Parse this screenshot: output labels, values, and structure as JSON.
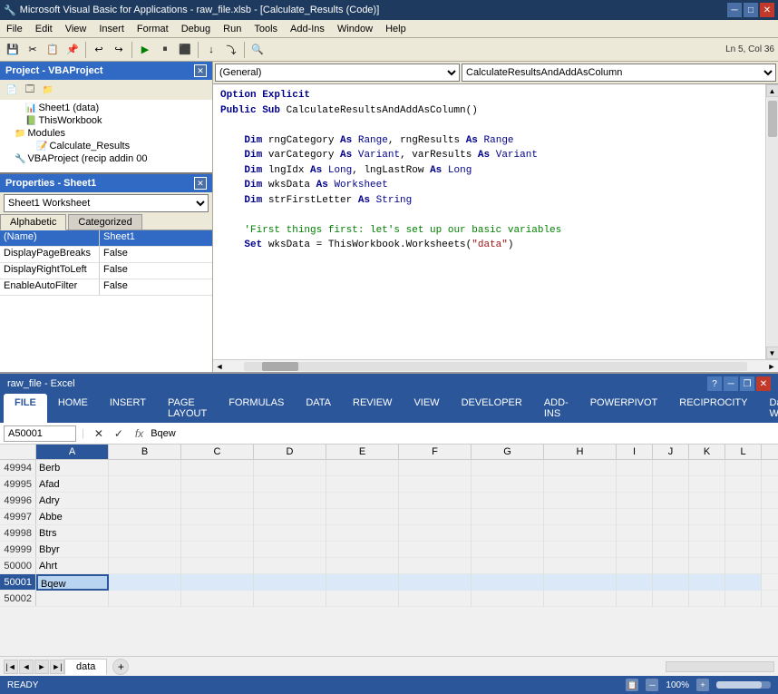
{
  "titleBar": {
    "title": "Microsoft Visual Basic for Applications - raw_file.xlsb - [Calculate_Results (Code)]",
    "minLabel": "─",
    "maxLabel": "□",
    "closeLabel": "✕"
  },
  "vbeMenubar": {
    "items": [
      "File",
      "Edit",
      "View",
      "Insert",
      "Format",
      "Debug",
      "Run",
      "Tools",
      "Add-Ins",
      "Window",
      "Help"
    ]
  },
  "vbeToolbar": {
    "statusText": "Ln 5, Col 36"
  },
  "projectPanel": {
    "title": "Project - VBAProject",
    "tree": [
      {
        "label": "Sheet1 (data)",
        "indent": 2
      },
      {
        "label": "ThisWorkbook",
        "indent": 2
      },
      {
        "label": "Modules",
        "indent": 1
      },
      {
        "label": "Calculate_Results",
        "indent": 3
      },
      {
        "label": "VBAProject (recip addin 00",
        "indent": 1
      }
    ]
  },
  "propertiesPanel": {
    "title": "Properties - Sheet1",
    "selectValue": "Sheet1  Worksheet",
    "tabs": [
      "Alphabetic",
      "Categorized"
    ],
    "activeTab": "Alphabetic",
    "rows": [
      {
        "name": "(Name)",
        "value": "Sheet1",
        "selected": true
      },
      {
        "name": "DisplayPageBreaks",
        "value": "False",
        "selected": false
      },
      {
        "name": "DisplayRightToLeft",
        "value": "False",
        "selected": false
      },
      {
        "name": "EnableAutoFilter",
        "value": "False",
        "selected": false
      }
    ]
  },
  "codeEditor": {
    "dropdownLeft": "(General)",
    "dropdownRight": "CalculateResultsAndAddAsColumn",
    "lines": [
      {
        "text": "Option Explicit",
        "type": "keyword"
      },
      {
        "text": "Public Sub CalculateResultsAndAddAsColumn()",
        "type": "mixed"
      },
      {
        "text": "",
        "type": "plain"
      },
      {
        "text": "    Dim rngCategory As Range, rngResults As Range",
        "type": "mixed"
      },
      {
        "text": "    Dim varCategory As Variant, varResults As Variant",
        "type": "mixed"
      },
      {
        "text": "    Dim lngIdx As Long, lngLastRow As Long",
        "type": "mixed"
      },
      {
        "text": "    Dim wksData As Worksheet",
        "type": "mixed"
      },
      {
        "text": "    Dim strFirstLetter As String",
        "type": "mixed"
      },
      {
        "text": "",
        "type": "plain"
      },
      {
        "text": "    'First things first: let's set up our basic variables",
        "type": "comment"
      },
      {
        "text": "    Set wksData = ThisWorkbook.Worksheets(\"data\")",
        "type": "mixed"
      }
    ]
  },
  "excelTitle": {
    "title": "raw_file - Excel",
    "helpBtn": "?",
    "minLabel": "─",
    "maxLabel": "□",
    "restoreLabel": "❐",
    "closeLabel": "✕"
  },
  "excelRibbon": {
    "tabs": [
      "FILE",
      "HOME",
      "INSERT",
      "PAGE LAYOUT",
      "FORMULAS",
      "DATA",
      "REVIEW",
      "VIEW",
      "DEVELOPER",
      "ADD-INS",
      "POWERPIVOT",
      "RECIPROCITY",
      "Dan Wag..."
    ],
    "activeTab": "FILE"
  },
  "formulaBar": {
    "nameBox": "A50001",
    "fxLabel": "fx",
    "value": "Bqew",
    "cancelBtn": "✕",
    "confirmBtn": "✓"
  },
  "columnHeaders": [
    "A",
    "B",
    "C",
    "D",
    "E",
    "F",
    "G",
    "H",
    "I",
    "J",
    "K",
    "L"
  ],
  "gridRows": [
    {
      "rowNum": "49994",
      "a": "Berb",
      "b": "",
      "c": "",
      "d": "",
      "e": "",
      "f": "",
      "g": "",
      "h": ""
    },
    {
      "rowNum": "49995",
      "a": "Afad",
      "b": "",
      "c": "",
      "d": "",
      "e": "",
      "f": "",
      "g": "",
      "h": ""
    },
    {
      "rowNum": "49996",
      "a": "Adry",
      "b": "",
      "c": "",
      "d": "",
      "e": "",
      "f": "",
      "g": "",
      "h": ""
    },
    {
      "rowNum": "49997",
      "a": "Abbe",
      "b": "",
      "c": "",
      "d": "",
      "e": "",
      "f": "",
      "g": "",
      "h": ""
    },
    {
      "rowNum": "49998",
      "a": "Btrs",
      "b": "",
      "c": "",
      "d": "",
      "e": "",
      "f": "",
      "g": "",
      "h": ""
    },
    {
      "rowNum": "49999",
      "a": "Bbyr",
      "b": "",
      "c": "",
      "d": "",
      "e": "",
      "f": "",
      "g": "",
      "h": ""
    },
    {
      "rowNum": "50000",
      "a": "Ahrt",
      "b": "",
      "c": "",
      "d": "",
      "e": "",
      "f": "",
      "g": "",
      "h": ""
    },
    {
      "rowNum": "50001",
      "a": "Bqew",
      "b": "",
      "c": "",
      "d": "",
      "e": "",
      "f": "",
      "g": "",
      "h": "",
      "selected": true
    },
    {
      "rowNum": "50002",
      "a": "",
      "b": "",
      "c": "",
      "d": "",
      "e": "",
      "f": "",
      "g": "",
      "h": ""
    }
  ],
  "sheetTabs": [
    {
      "label": "data",
      "active": true
    }
  ],
  "addSheetLabel": "+",
  "statusBar": {
    "ready": "READY",
    "zoom": "100%"
  }
}
